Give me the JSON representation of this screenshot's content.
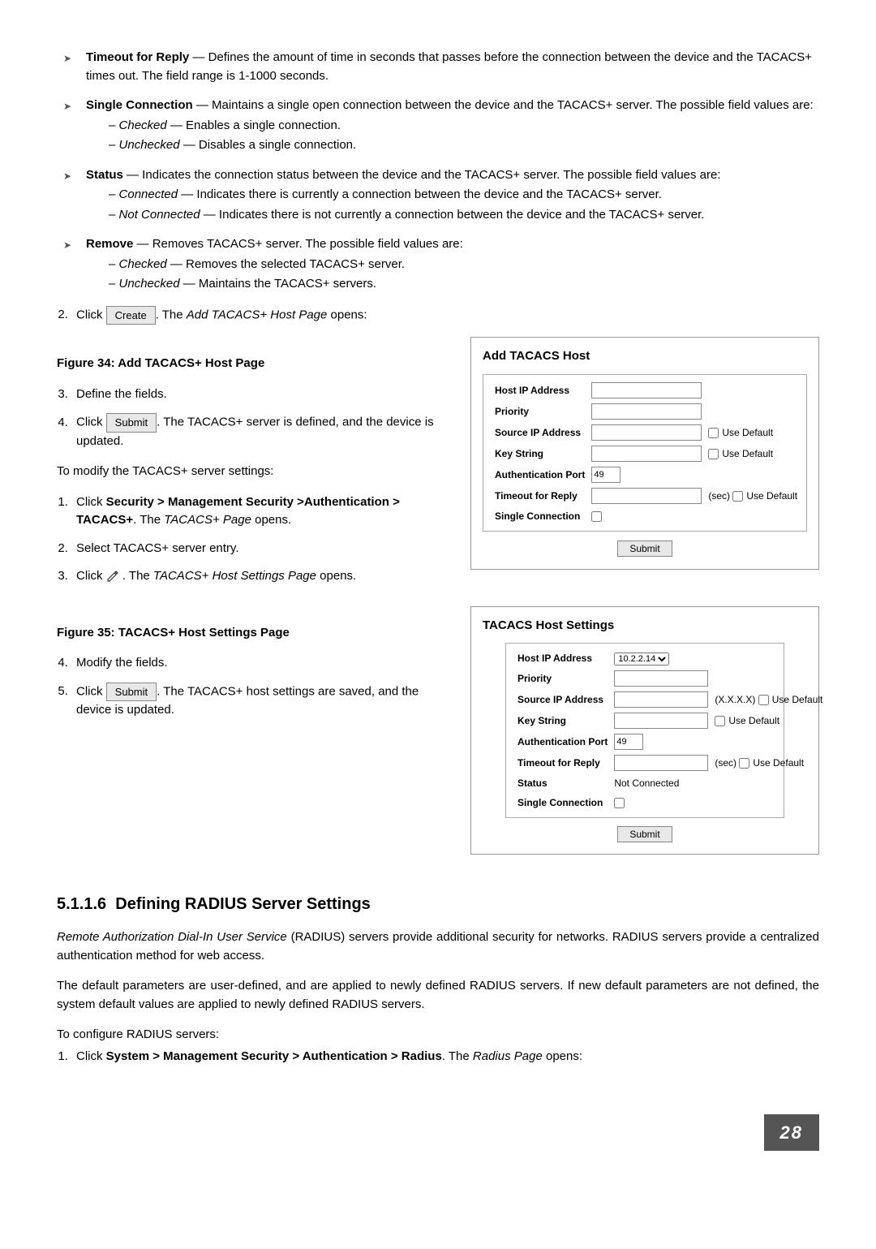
{
  "bullets": {
    "timeout": {
      "label": "Timeout for Reply",
      "text": " — Defines the amount of time in seconds that passes before the connection between the device and the TACACS+ times out. The field range is 1-1000 seconds."
    },
    "single": {
      "label": "Single Connection",
      "text": " — Maintains a single open connection between the device and the TACACS+ server. The possible field values are:",
      "checked_label": "Checked",
      "checked_text": " — Enables a single connection.",
      "unchecked_label": "Unchecked",
      "unchecked_text": " — Disables a single connection."
    },
    "status": {
      "label": "Status",
      "text": " — Indicates the connection status between the device and the TACACS+ server. The possible field values are:",
      "connected_label": "Connected",
      "connected_text": " — Indicates there is currently a connection between the device and the TACACS+ server.",
      "notconnected_label": "Not Connected",
      "notconnected_text": " — Indicates there is not currently a connection between the device and the TACACS+ server."
    },
    "remove": {
      "label": "Remove",
      "text": " — Removes TACACS+ server. The possible field values are:",
      "checked_label": "Checked",
      "checked_text": " — Removes the selected TACACS+ server.",
      "unchecked_label": "Unchecked",
      "unchecked_text": " — Maintains the TACACS+ servers."
    }
  },
  "step2": {
    "pre": "Click ",
    "btn": "Create",
    "post": ". The ",
    "page": "Add TACACS+ Host Page",
    "opens": " opens:"
  },
  "fig34": "Figure 34: Add TACACS+ Host Page",
  "left34": {
    "step3": "Define the fields.",
    "step4_pre": "Click ",
    "step4_btn": "Submit",
    "step4_post": ". The TACACS+ server is defined, and the device is updated.",
    "modify_intro": "To modify the TACACS+ server settings:",
    "m1_pre": "Click ",
    "m1_bold": "Security > Management Security >Authentication > TACACS+",
    "m1_post": ". The ",
    "m1_page": "TACACS+ Page",
    "m1_opens": " opens.",
    "m2": "Select TACACS+ server entry.",
    "m3_pre": "Click ",
    "m3_post": " . The ",
    "m3_page": "TACACS+ Host Settings Page",
    "m3_opens": " opens."
  },
  "panel34": {
    "title": "Add TACACS Host",
    "host_ip": "Host IP Address",
    "priority": "Priority",
    "source_ip": "Source IP Address",
    "key_string": "Key String",
    "auth_port": "Authentication Port",
    "auth_port_val": "49",
    "timeout": "Timeout for Reply",
    "sec": "(sec)",
    "single_conn": "Single Connection",
    "use_default": "Use Default",
    "submit": "Submit"
  },
  "fig35": "Figure 35: TACACS+ Host Settings Page",
  "left35": {
    "step4": "Modify the fields.",
    "step5_pre": "Click ",
    "step5_btn": "Submit",
    "step5_post": ". The TACACS+ host settings are saved, and the device is updated."
  },
  "panel35": {
    "title": "TACACS Host Settings",
    "host_ip": "Host IP Address",
    "host_ip_val": "10.2.2.14",
    "priority": "Priority",
    "source_ip": "Source IP Address",
    "xxxx": "(X.X.X.X)",
    "key_string": "Key String",
    "auth_port": "Authentication Port",
    "auth_port_val": "49",
    "timeout": "Timeout for Reply",
    "sec": "(sec)",
    "status": "Status",
    "status_val": "Not Connected",
    "single_conn": "Single Connection",
    "use_default": "Use Default",
    "submit": "Submit"
  },
  "sec5116": {
    "heading_num": "5.1.1.6",
    "heading_text": "Defining RADIUS Server Settings",
    "p1_italic": "Remote Authorization Dial-In User Service",
    "p1_rest": " (RADIUS) servers provide additional security for networks. RADIUS servers provide a centralized authentication method for web access.",
    "p2": "The default parameters are user-defined, and are applied to newly defined RADIUS servers. If new default parameters are not defined, the system default values are applied to newly defined RADIUS servers.",
    "intro": "To configure RADIUS servers:",
    "s1_pre": "Click ",
    "s1_bold": "System > Management Security > Authentication > Radius",
    "s1_post": ". The ",
    "s1_page": "Radius Page",
    "s1_opens": " opens:"
  },
  "page_number": "28"
}
